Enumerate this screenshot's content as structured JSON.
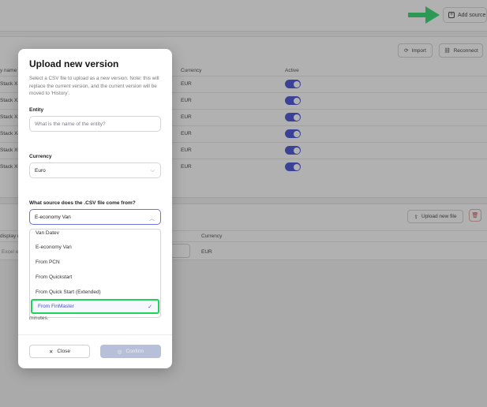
{
  "header": {
    "add_source_label": "Add source"
  },
  "panel1": {
    "import_label": "Import",
    "reconnect_label": "Reconnect",
    "columns": {
      "name": "y name",
      "currency": "Currency",
      "active": "Active"
    },
    "rows": [
      {
        "name": "Stack X1",
        "currency": "EUR"
      },
      {
        "name": "Stack X2",
        "currency": "EUR"
      },
      {
        "name": "Stack X3",
        "currency": "EUR"
      },
      {
        "name": "Stack X4",
        "currency": "EUR"
      },
      {
        "name": "Stack X5",
        "currency": "EUR"
      },
      {
        "name": "Stack X6",
        "currency": "EUR"
      }
    ]
  },
  "panel2": {
    "upload_label": "Upload new file",
    "columns": {
      "name": "display n",
      "currency": "Currency"
    },
    "row": {
      "name": "Excel ex",
      "currency": "EUR"
    }
  },
  "modal": {
    "title": "Upload new version",
    "description": "Select a CSV file to upload as a new version. Note: this will replace the current version, and the current version will be moved to 'History'.",
    "entity_label": "Entity",
    "entity_placeholder": "What is the name of the entity?",
    "currency_label": "Currency",
    "currency_value": "Euro",
    "source_label": "What source does the .CSV file come from?",
    "source_value": "E-economy Van",
    "options": [
      "Van Datev",
      "E-economy Van",
      "From PCN",
      "From Quickstart",
      "From Quick Start (Extended)",
      "From FinMaster"
    ],
    "selected_option": "From FinMaster",
    "minutes_text": "minutes.",
    "close_label": "Close",
    "confirm_label": "Confirm"
  },
  "colors": {
    "accent": "#3a47d4",
    "highlight": "#1fd25a",
    "arrow": "#22d865"
  }
}
